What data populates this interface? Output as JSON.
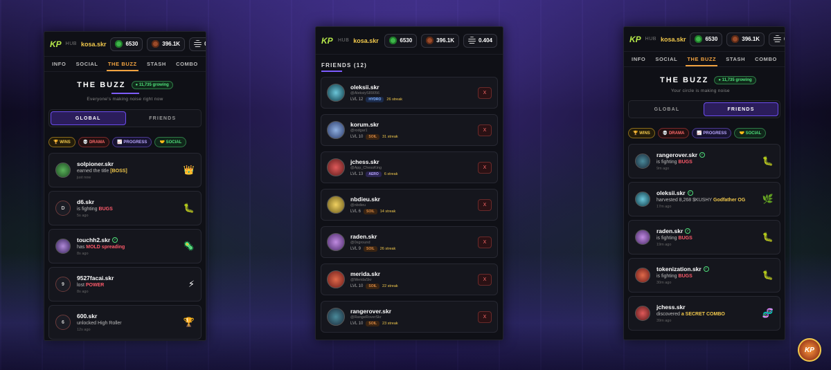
{
  "header": {
    "logo": "KP",
    "hub": "HUB",
    "user": "kosa.skr",
    "stats": [
      {
        "icon": "green-bud-icon",
        "value": "6530"
      },
      {
        "icon": "bronze-coin-icon",
        "value": "396.1K"
      },
      {
        "icon": "menu-lines-icon",
        "value": "0.404"
      }
    ]
  },
  "tabs": [
    "INFO",
    "SOCIAL",
    "THE BUZZ",
    "STASH",
    "COMBO"
  ],
  "buzz": {
    "title": "THE BUZZ",
    "growing": "● 11,735 growing",
    "global_subtitle": "Everyone's making noise right now",
    "friends_subtitle": "Your circle is making noise",
    "seg_global": "GLOBAL",
    "seg_friends": "FRIENDS"
  },
  "filters": [
    "🏆 WINS",
    "💀 DRAMA",
    "📈 PROGRESS",
    "🤝 SOCIAL"
  ],
  "global_feed": [
    {
      "name": "solpioner.skr",
      "pre": "earned the title",
      "hl": "[BOSS]",
      "time": "just now",
      "icon": "👑",
      "num": ""
    },
    {
      "name": "d6.skr",
      "pre": "is fighting",
      "hl": "BUGS",
      "time": "5s ago",
      "icon": "🐛",
      "num": "D"
    },
    {
      "name": "touchh2.skr",
      "pre": "has",
      "hl": "MOLD spreading",
      "time": "8s ago",
      "icon": "🦠",
      "num": ""
    },
    {
      "name": "9527facai.skr",
      "pre": "lost",
      "hl": "POWER",
      "time": "8s ago",
      "icon": "⚡",
      "num": "9"
    },
    {
      "name": "600.skr",
      "pre": "unlocked High Roller",
      "hl": "",
      "time": "12s ago",
      "icon": "🏆",
      "num": "6"
    }
  ],
  "friends": {
    "title": "FRIENDS (12)",
    "list": [
      {
        "name": "oleksii.skr",
        "handle": "@AleksiyS89056",
        "lvl": "LVL 12",
        "badge": "HYDRO",
        "streak": "26 streak"
      },
      {
        "name": "korum.skr",
        "handle": "@rodgar1",
        "lvl": "LVL 10",
        "badge": "SOIL",
        "streak": "31 streak"
      },
      {
        "name": "jchess.skr",
        "handle": "@App_ChessKing",
        "lvl": "LVL 13",
        "badge": "AERO",
        "streak": "6 streak"
      },
      {
        "name": "nbdieu.skr",
        "handle": "@nbdieu",
        "lvl": "LVL 6",
        "badge": "SOIL",
        "streak": "14 streak"
      },
      {
        "name": "raden.skr",
        "handle": "@0xground",
        "lvl": "LVL 9",
        "badge": "SOIL",
        "streak": "26 streak"
      },
      {
        "name": "merida.skr",
        "handle": "@MeridaSkr",
        "lvl": "LVL 10",
        "badge": "SOIL",
        "streak": "22 streak"
      },
      {
        "name": "rangerover.skr",
        "handle": "@RangeRoverSkr",
        "lvl": "LVL 10",
        "badge": "SOIL",
        "streak": "23 streak"
      }
    ],
    "remove": "X"
  },
  "friends_feed": [
    {
      "name": "rangerover.skr",
      "pre": "is fighting",
      "hl": "BUGS",
      "post": "",
      "time": "9m ago",
      "icon": "🐛"
    },
    {
      "name": "oleksii.skr",
      "pre": "harvested 8,268 $KUSHY",
      "hl": "Godfather OG",
      "post": "",
      "time": "17m ago",
      "icon": "🌿"
    },
    {
      "name": "raden.skr",
      "pre": "is fighting",
      "hl": "BUGS",
      "post": "",
      "time": "19m ago",
      "icon": "🐛"
    },
    {
      "name": "tokenization.skr",
      "pre": "is fighting",
      "hl": "BUGS",
      "post": "",
      "time": "30m ago",
      "icon": "🐛"
    },
    {
      "name": "jchess.skr",
      "pre": "discovered",
      "hl": "a SECRET COMBO",
      "post": "",
      "time": "39m ago",
      "icon": "🧬"
    }
  ],
  "corner_logo": "KP"
}
